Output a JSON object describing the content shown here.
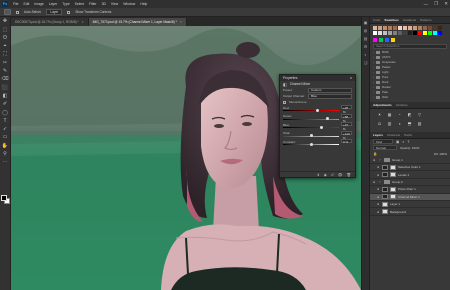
{
  "app": {
    "logo": "Ps"
  },
  "menu": [
    "File",
    "Edit",
    "Image",
    "Layer",
    "Type",
    "Select",
    "Filter",
    "3D",
    "View",
    "Window",
    "Help"
  ],
  "window_controls": [
    "—",
    "❐",
    "✕"
  ],
  "options_bar": {
    "auto_select_label": "Auto-Select:",
    "layer_dropdown": "Layer",
    "transform_label": "Show Transform Controls"
  },
  "tabs": [
    {
      "label": "DSC00573.psd @ 16.7% (Group 1, RGB/8) *",
      "active": false
    },
    {
      "label": "IMG_7573.psd @ 15.7% (Channel Mixer 1, Layer Mask/8) *",
      "active": true
    }
  ],
  "tools": [
    "✥",
    "⬚",
    "ʘ",
    "⌖",
    "⛶",
    "✂",
    "✎",
    "⌫",
    "⬛",
    "◧",
    "✐",
    "◯",
    "T",
    "➶",
    "▭",
    "✋",
    "⚲",
    "⋯"
  ],
  "right_strip_icons": [
    "▣",
    "◍",
    "▤",
    "⚙",
    "◐",
    "❏"
  ],
  "panels": {
    "swatches_tabs": [
      "Color",
      "Swatches",
      "Gradients",
      "Patterns"
    ],
    "swatch_colors": [
      "#d9b8a0",
      "#cf9f82",
      "#c48c6d",
      "#b87a5b",
      "#a6684a",
      "#f2d5c0",
      "#e6c0a6",
      "#dcb090",
      "#c89a78",
      "#ad8063",
      "#8d654c",
      "#6f4d38",
      "#523727",
      "#3a2619",
      "#ffffff",
      "#e0e0e0",
      "#c0c0c0",
      "#a0a0a0",
      "#808080",
      "#606060",
      "#404040",
      "#202020",
      "#000000",
      "#ff0000",
      "#ffff00",
      "#00ff00",
      "#00ffff",
      "#0000ff"
    ],
    "swatch_highlight_colors": [
      "#ff00ff",
      "#00c853",
      "#2962ff",
      "#ffd600"
    ],
    "search_placeholder": "Search Swatches",
    "swatch_groups": [
      "RGB",
      "CMYK",
      "Grayscale",
      "Pastel",
      "Light",
      "Pure",
      "Dark",
      "Darker",
      "Pale",
      "Web"
    ],
    "adjustments_tabs": [
      "Adjustments",
      "Libraries"
    ],
    "adjustment_icons": [
      "☀",
      "▦",
      "◔",
      "◩",
      "▽",
      "⚖",
      "▥",
      "◑",
      "⬒",
      "▨"
    ],
    "layers_tabs": [
      "Layers",
      "Channels",
      "Paths"
    ],
    "layers_kind": "Kind",
    "blend_mode": "Normal",
    "opacity": "Opacity: 100%",
    "fill": "Fill: 100%",
    "layers": [
      {
        "name": "Group 1",
        "type": "group",
        "selected": false
      },
      {
        "name": "Selective Color 1",
        "type": "adjust",
        "selected": false
      },
      {
        "name": "Levels 1",
        "type": "adjust",
        "selected": false
      },
      {
        "name": "Group 2",
        "type": "group",
        "selected": false
      },
      {
        "name": "Photo Filter 1",
        "type": "adjust",
        "selected": false
      },
      {
        "name": "Channel Mixer 1",
        "type": "adjust",
        "selected": true
      },
      {
        "name": "Layer 1",
        "type": "pixel",
        "selected": false
      },
      {
        "name": "Background",
        "type": "pixel",
        "selected": false
      }
    ]
  },
  "properties": {
    "title": "Properties",
    "subtitle": "Channel Mixer",
    "preset_label": "Preset:",
    "preset_value": "Custom",
    "output_label": "Output Channel:",
    "output_value": "Blue",
    "monochrome": "Monochrome",
    "sliders": [
      {
        "label": "Red:",
        "value": "+25 %",
        "level": 0.62
      },
      {
        "label": "Green:",
        "value": "+58 %",
        "level": 0.79
      },
      {
        "label": "Blue:",
        "value": "+37 %",
        "level": 0.68
      },
      {
        "label": "Total:",
        "value": "+120 %",
        "level": 0.5
      },
      {
        "label": "Constant:",
        "value": "0 %",
        "level": 0.5
      }
    ]
  }
}
